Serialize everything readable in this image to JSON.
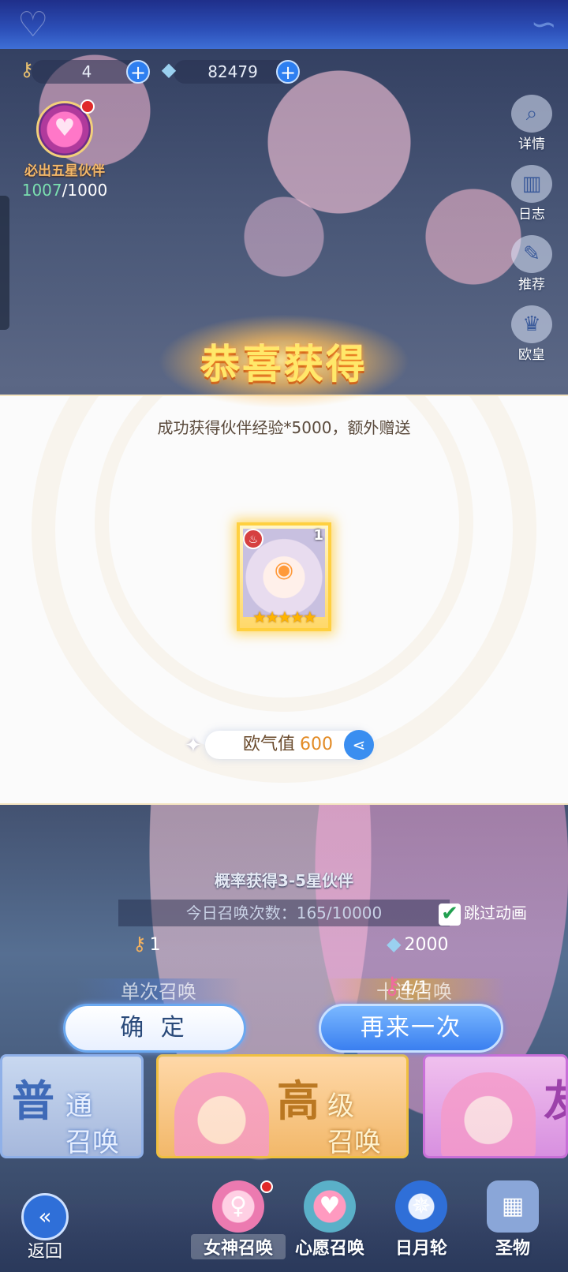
{
  "resources": {
    "keys": {
      "icon": "key-icon",
      "value": "4"
    },
    "crystals": {
      "icon": "crystal-icon",
      "value": "82479"
    }
  },
  "guarantee": {
    "label": "必出五星伙伴",
    "current": "1007",
    "sep_total": "/1000"
  },
  "side_menu": [
    {
      "icon": "magnifier-icon",
      "label": "详情"
    },
    {
      "icon": "book-icon",
      "label": "日志"
    },
    {
      "icon": "quill-icon",
      "label": "推荐"
    },
    {
      "icon": "crown-icon",
      "label": "欧皇"
    }
  ],
  "result": {
    "title": "恭喜获得",
    "description": "成功获得伙伴经验*5000，额外赠送",
    "card": {
      "level": "1",
      "stars": 5
    },
    "luck_label": "欧气值",
    "luck_value": "600"
  },
  "summon": {
    "subtitle": "概率获得3-5星伙伴",
    "today_count": "今日召唤次数：165/10000",
    "skip_label": "跳过动画",
    "single_cost": "1",
    "ten_cost": "2000",
    "key_count": "4/1",
    "single_tab": "单次召唤",
    "ten_tab": "十连召唤",
    "confirm": "确 定",
    "again": "再来一次"
  },
  "pools": [
    {
      "big": "普",
      "rest": "通\n召唤"
    },
    {
      "big": "高",
      "rest": "级\n召唤"
    },
    {
      "big": "友",
      "rest": ""
    }
  ],
  "nav": {
    "back": "返回",
    "tabs": [
      "女神召唤",
      "心愿召唤",
      "日月轮",
      "圣物"
    ]
  },
  "colors": {
    "accent_blue": "#3a7ff0",
    "title_gold": "#ffe86a",
    "luck_orange": "#e28a24",
    "current_green": "#7be0b0"
  }
}
